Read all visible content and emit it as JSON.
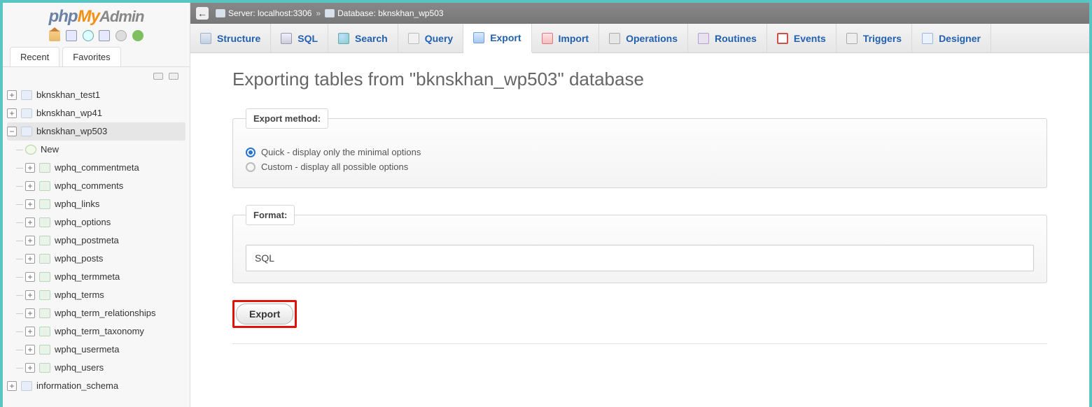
{
  "logo": {
    "p1": "php",
    "p2": "My",
    "p3": "Admin"
  },
  "sidebarTabs": {
    "recent": "Recent",
    "favorites": "Favorites"
  },
  "tree": {
    "items": [
      {
        "label": "bknskhan_test1"
      },
      {
        "label": "bknskhan_wp41"
      },
      {
        "label": "bknskhan_wp503"
      }
    ],
    "new": "New",
    "tables": [
      "wphq_commentmeta",
      "wphq_comments",
      "wphq_links",
      "wphq_options",
      "wphq_postmeta",
      "wphq_posts",
      "wphq_termmeta",
      "wphq_terms",
      "wphq_term_relationships",
      "wphq_term_taxonomy",
      "wphq_usermeta",
      "wphq_users"
    ],
    "extra": "information_schema"
  },
  "serverbar": {
    "server_label": "Server:",
    "server": "localhost:3306",
    "sep": "»",
    "database_label": "Database:",
    "database": "bknskhan_wp503"
  },
  "topnav": [
    {
      "label": "Structure"
    },
    {
      "label": "SQL"
    },
    {
      "label": "Search"
    },
    {
      "label": "Query"
    },
    {
      "label": "Export"
    },
    {
      "label": "Import"
    },
    {
      "label": "Operations"
    },
    {
      "label": "Routines"
    },
    {
      "label": "Events"
    },
    {
      "label": "Triggers"
    },
    {
      "label": "Designer"
    }
  ],
  "page": {
    "title": "Exporting tables from \"bknskhan_wp503\" database",
    "export_method": "Export method:",
    "quick": "Quick - display only the minimal options",
    "custom": "Custom - display all possible options",
    "format": "Format:",
    "format_value": "SQL",
    "export_btn": "Export"
  }
}
